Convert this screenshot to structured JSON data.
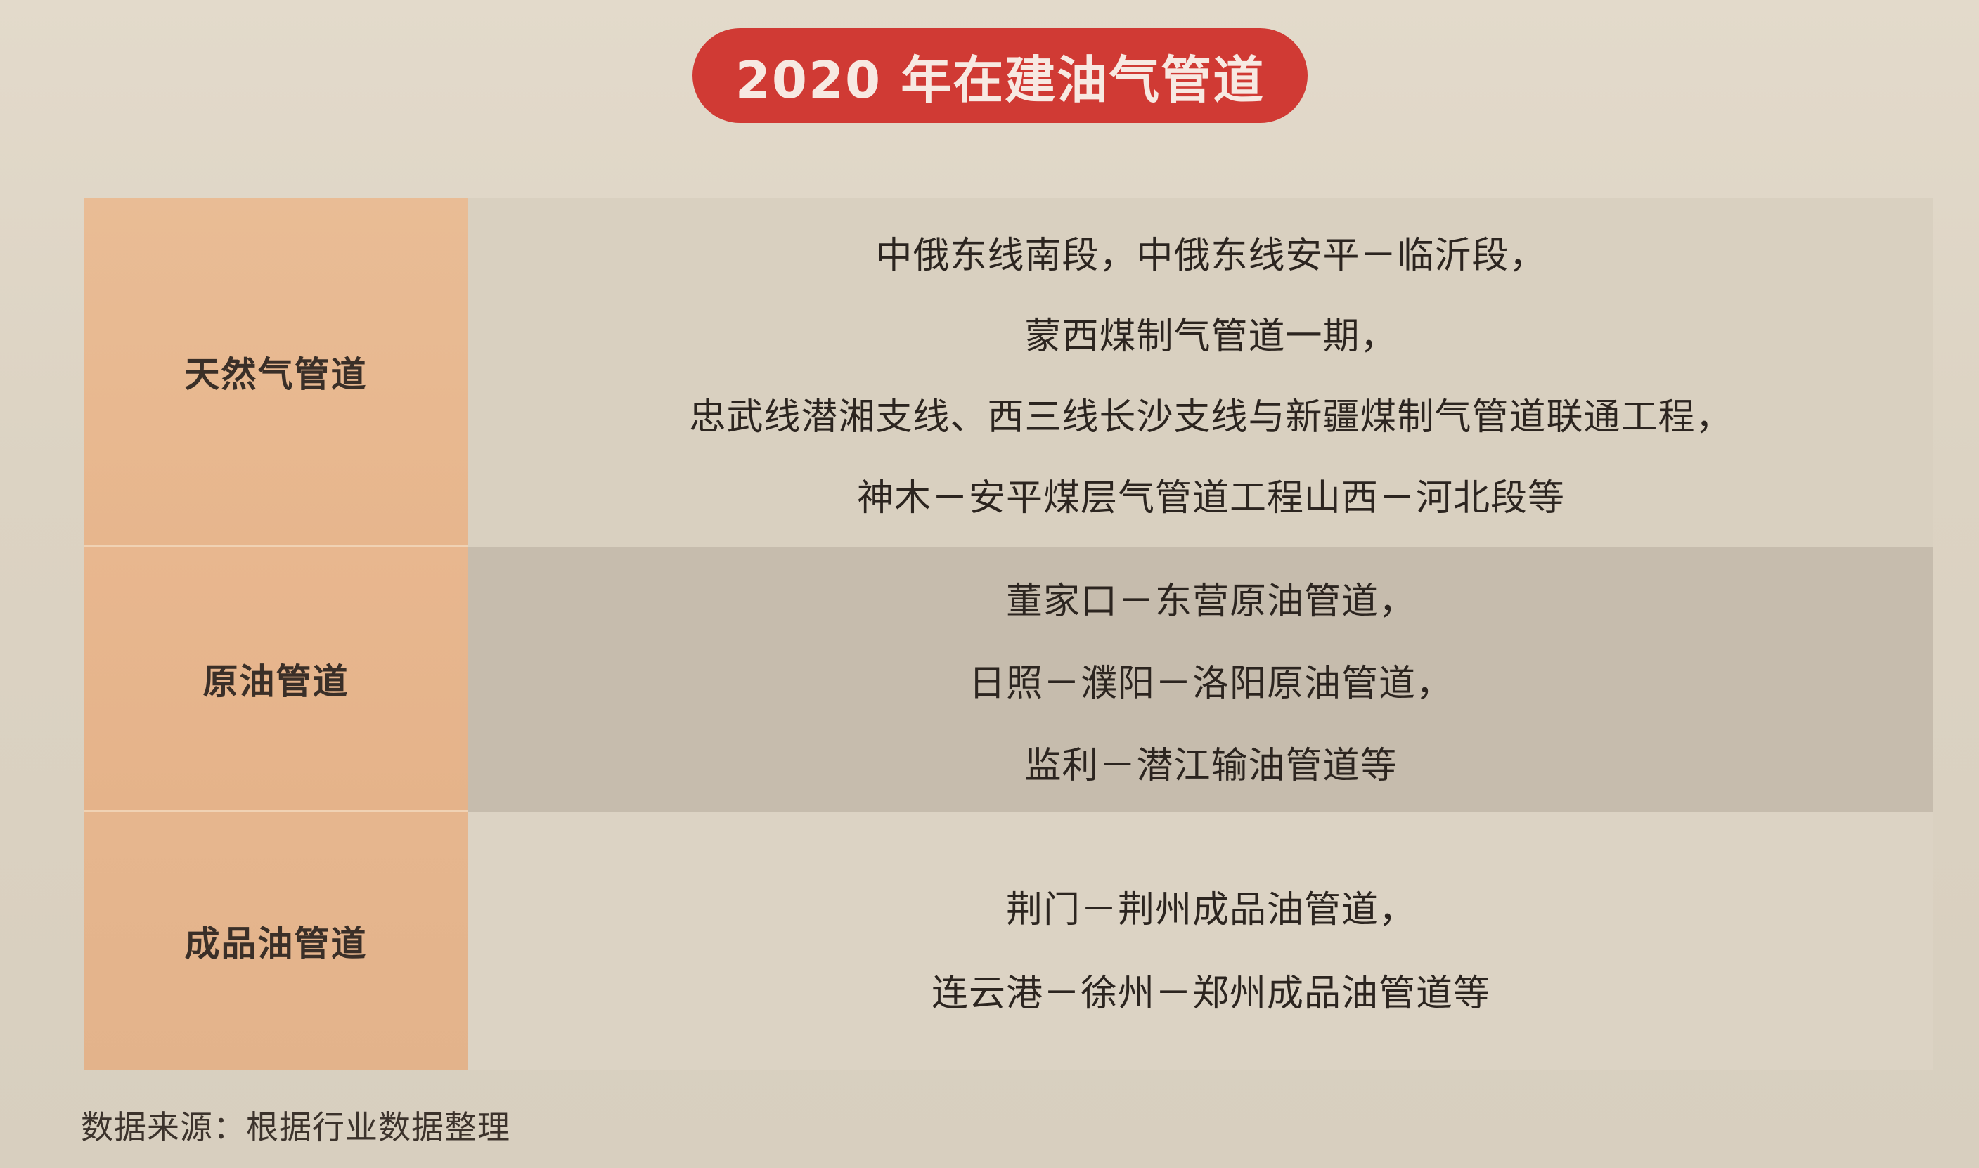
{
  "title": "2020 年在建油气管道",
  "rows": [
    {
      "category": "天然气管道",
      "lines": [
        "中俄东线南段，中俄东线安平－临沂段，",
        "蒙西煤制气管道一期，",
        "忠武线潜湘支线、西三线长沙支线与新疆煤制气管道联通工程，",
        "神木－安平煤层气管道工程山西－河北段等"
      ]
    },
    {
      "category": "原油管道",
      "lines": [
        "董家口－东营原油管道，",
        "日照－濮阳－洛阳原油管道，",
        "监利－潜江输油管道等"
      ]
    },
    {
      "category": "成品油管道",
      "lines": [
        "荆门－荆州成品油管道，",
        "连云港－徐州－郑州成品油管道等"
      ]
    }
  ],
  "source": "数据来源：根据行业数据整理",
  "colors": {
    "title_pill": "#d03a34",
    "category_bg": "#e8b991",
    "page_bg": "#ded5c6"
  }
}
